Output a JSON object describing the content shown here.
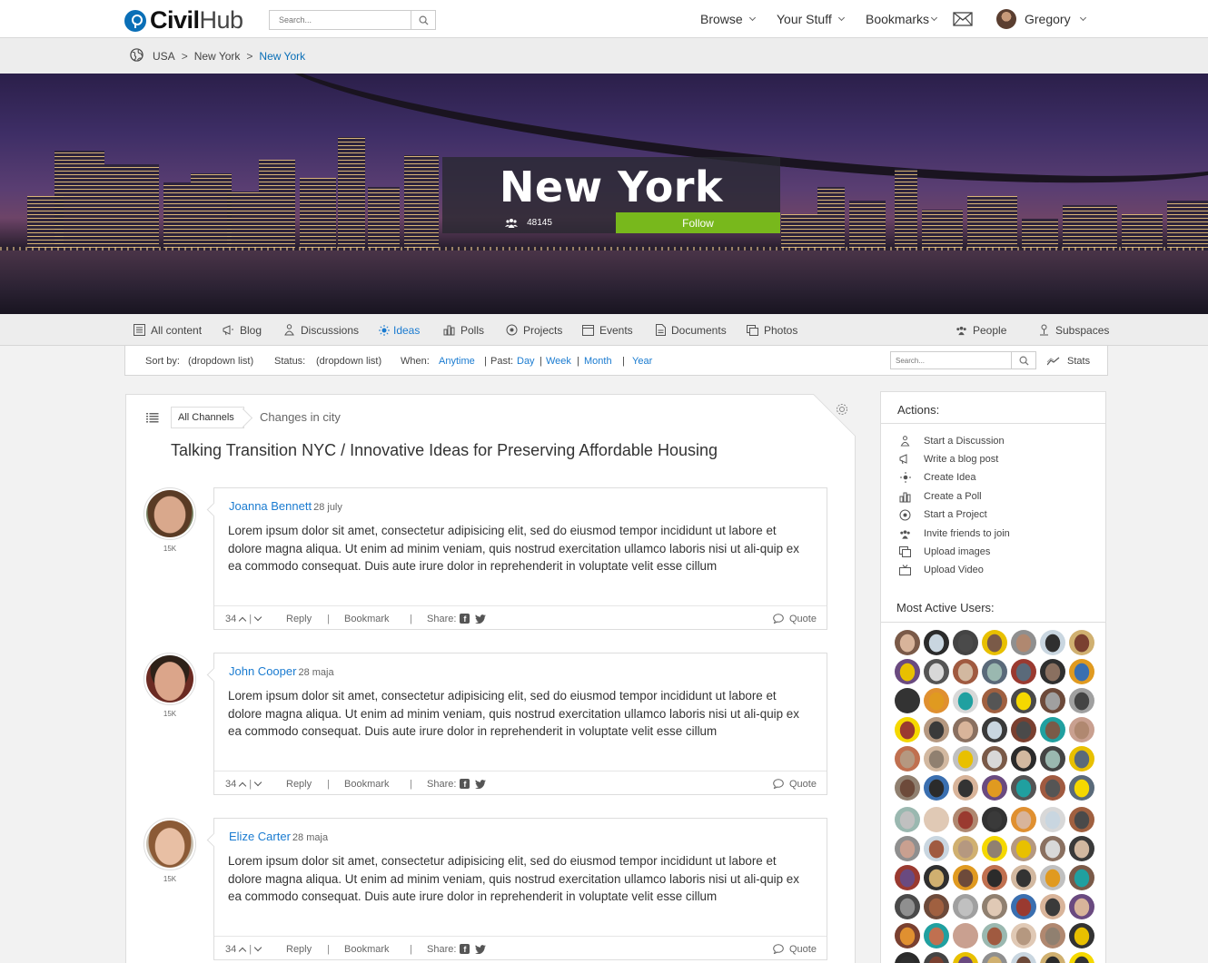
{
  "brand": {
    "name_part1": "Civil",
    "name_part2": "Hub"
  },
  "top_search": {
    "placeholder": "Search..."
  },
  "topnav": {
    "browse": "Browse",
    "your_stuff": "Your Stuff",
    "bookmarks": "Bookmarks",
    "user": "Gregory"
  },
  "breadcrumb": {
    "items": [
      "USA",
      "New York",
      "New York"
    ],
    "separator": ">"
  },
  "hero": {
    "title": "New York",
    "members": "48145",
    "follow": "Follow"
  },
  "tabs": {
    "all_content": "All content",
    "blog": "Blog",
    "discussions": "Discussions",
    "ideas": "Ideas",
    "polls": "Polls",
    "projects": "Projects",
    "events": "Events",
    "documents": "Documents",
    "photos": "Photos",
    "people": "People",
    "subspaces": "Subspaces"
  },
  "filter": {
    "sort_label": "Sort by:",
    "sort_value": "(dropdown list)",
    "status_label": "Status:",
    "status_value": "(dropdown list)",
    "when_label": "When:",
    "anytime": "Anytime",
    "past_label": "Past:",
    "day": "Day",
    "week": "Week",
    "month": "Month",
    "year": "Year",
    "search_placeholder": "Search...",
    "stats": "Stats",
    "bar": "|"
  },
  "thread": {
    "channel": "All Channels",
    "subchannel": "Changes in city",
    "title": "Talking Transition NYC / Innovative Ideas for Preserving Affordable Housing"
  },
  "comments": [
    {
      "name": "Joanna Bennett",
      "date": "28 july",
      "score": "15K",
      "text": "Lorem ipsum dolor sit amet, consectetur adipisicing elit, sed do eiusmod tempor incididunt ut labore et dolore magna aliqua. Ut enim ad minim veniam, quis nostrud exercitation ullamco laboris nisi ut ali-quip ex ea commodo consequat. Duis aute irure dolor in reprehenderit in voluptate velit esse cillum",
      "votes": "34"
    },
    {
      "name": "John Cooper",
      "date": "28 maja",
      "score": "15K",
      "text": "Lorem ipsum dolor sit amet, consectetur adipisicing elit, sed do eiusmod tempor incididunt ut labore et dolore magna aliqua. Ut enim ad minim veniam, quis nostrud exercitation ullamco laboris nisi ut ali-quip ex ea commodo consequat. Duis aute irure dolor in reprehenderit in voluptate velit esse cillum",
      "votes": "34"
    },
    {
      "name": "Elize Carter",
      "date": "28 maja",
      "score": "15K",
      "text": "Lorem ipsum dolor sit amet, consectetur adipisicing elit, sed do eiusmod tempor incididunt ut labore et dolore magna aliqua. Ut enim ad minim veniam, quis nostrud exercitation ullamco laboris nisi ut ali-quip ex ea commodo consequat. Duis aute irure dolor in reprehenderit in voluptate velit esse cillum",
      "votes": "34"
    }
  ],
  "comment_actions": {
    "reply": "Reply",
    "bookmark": "Bookmark",
    "share": "Share:",
    "quote": "Quote",
    "bar": "|"
  },
  "sidebar": {
    "actions_title": "Actions:",
    "actions": [
      "Start a Discussion",
      "Write a blog post",
      "Create Idea",
      "Create a Poll",
      "Start a Project",
      "Invite friends to join",
      "Upload images",
      "Upload Video"
    ],
    "users_title": "Most Active Users:"
  },
  "colors": {
    "accent": "#1a7bd0",
    "brand": "#0a6fb7",
    "follow": "#78b81c"
  }
}
